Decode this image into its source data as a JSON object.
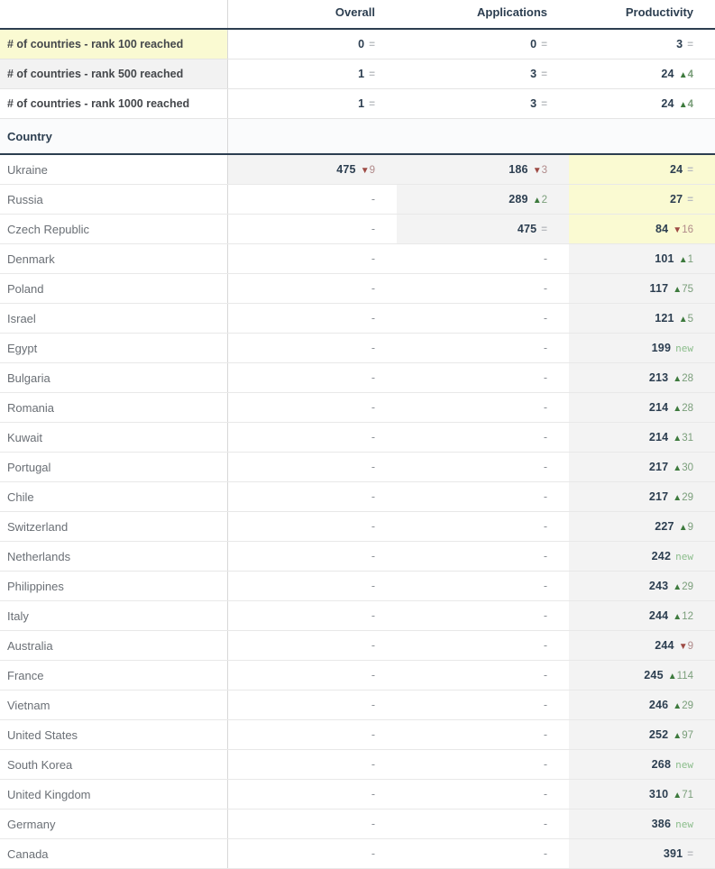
{
  "table": {
    "columns": [
      "",
      "Overall",
      "Applications",
      "Productivity"
    ],
    "summary_rows": [
      {
        "label": "# of countries - rank 100 reached",
        "highlight": "yellow",
        "cells": [
          {
            "value": "0",
            "delta": "=",
            "dir": "same"
          },
          {
            "value": "0",
            "delta": "=",
            "dir": "same"
          },
          {
            "value": "3",
            "delta": "=",
            "dir": "same"
          }
        ]
      },
      {
        "label": "# of countries - rank 500 reached",
        "highlight": "alt",
        "cells": [
          {
            "value": "1",
            "delta": "=",
            "dir": "same"
          },
          {
            "value": "3",
            "delta": "=",
            "dir": "same"
          },
          {
            "value": "24",
            "delta": "4",
            "dir": "up"
          }
        ]
      },
      {
        "label": "# of countries - rank 1000 reached",
        "highlight": "none",
        "cells": [
          {
            "value": "1",
            "delta": "=",
            "dir": "same"
          },
          {
            "value": "3",
            "delta": "=",
            "dir": "same"
          },
          {
            "value": "24",
            "delta": "4",
            "dir": "up"
          }
        ]
      }
    ],
    "section_label": "Country",
    "rows": [
      {
        "country": "Ukraine",
        "cells": [
          {
            "value": "475",
            "delta": "9",
            "dir": "down",
            "bg": "filled"
          },
          {
            "value": "186",
            "delta": "3",
            "dir": "down",
            "bg": "filled"
          },
          {
            "value": "24",
            "delta": "=",
            "dir": "same",
            "bg": "yellow"
          }
        ]
      },
      {
        "country": "Russia",
        "cells": [
          {
            "value": "-",
            "delta": "",
            "dir": "none",
            "bg": "white"
          },
          {
            "value": "289",
            "delta": "2",
            "dir": "up",
            "bg": "filled"
          },
          {
            "value": "27",
            "delta": "=",
            "dir": "same",
            "bg": "yellow"
          }
        ]
      },
      {
        "country": "Czech Republic",
        "cells": [
          {
            "value": "-",
            "delta": "",
            "dir": "none",
            "bg": "white"
          },
          {
            "value": "475",
            "delta": "=",
            "dir": "same",
            "bg": "filled"
          },
          {
            "value": "84",
            "delta": "16",
            "dir": "down",
            "bg": "yellow"
          }
        ]
      },
      {
        "country": "Denmark",
        "cells": [
          {
            "value": "-",
            "delta": "",
            "dir": "none",
            "bg": "white"
          },
          {
            "value": "-",
            "delta": "",
            "dir": "none",
            "bg": "white"
          },
          {
            "value": "101",
            "delta": "1",
            "dir": "up",
            "bg": "filled"
          }
        ]
      },
      {
        "country": "Poland",
        "cells": [
          {
            "value": "-",
            "delta": "",
            "dir": "none",
            "bg": "white"
          },
          {
            "value": "-",
            "delta": "",
            "dir": "none",
            "bg": "white"
          },
          {
            "value": "117",
            "delta": "75",
            "dir": "up",
            "bg": "filled"
          }
        ]
      },
      {
        "country": "Israel",
        "cells": [
          {
            "value": "-",
            "delta": "",
            "dir": "none",
            "bg": "white"
          },
          {
            "value": "-",
            "delta": "",
            "dir": "none",
            "bg": "white"
          },
          {
            "value": "121",
            "delta": "5",
            "dir": "up",
            "bg": "filled"
          }
        ]
      },
      {
        "country": "Egypt",
        "cells": [
          {
            "value": "-",
            "delta": "",
            "dir": "none",
            "bg": "white"
          },
          {
            "value": "-",
            "delta": "",
            "dir": "none",
            "bg": "white"
          },
          {
            "value": "199",
            "delta": "new",
            "dir": "new",
            "bg": "filled"
          }
        ]
      },
      {
        "country": "Bulgaria",
        "cells": [
          {
            "value": "-",
            "delta": "",
            "dir": "none",
            "bg": "white"
          },
          {
            "value": "-",
            "delta": "",
            "dir": "none",
            "bg": "white"
          },
          {
            "value": "213",
            "delta": "28",
            "dir": "up",
            "bg": "filled"
          }
        ]
      },
      {
        "country": "Romania",
        "cells": [
          {
            "value": "-",
            "delta": "",
            "dir": "none",
            "bg": "white"
          },
          {
            "value": "-",
            "delta": "",
            "dir": "none",
            "bg": "white"
          },
          {
            "value": "214",
            "delta": "28",
            "dir": "up",
            "bg": "filled"
          }
        ]
      },
      {
        "country": "Kuwait",
        "cells": [
          {
            "value": "-",
            "delta": "",
            "dir": "none",
            "bg": "white"
          },
          {
            "value": "-",
            "delta": "",
            "dir": "none",
            "bg": "white"
          },
          {
            "value": "214",
            "delta": "31",
            "dir": "up",
            "bg": "filled"
          }
        ]
      },
      {
        "country": "Portugal",
        "cells": [
          {
            "value": "-",
            "delta": "",
            "dir": "none",
            "bg": "white"
          },
          {
            "value": "-",
            "delta": "",
            "dir": "none",
            "bg": "white"
          },
          {
            "value": "217",
            "delta": "30",
            "dir": "up",
            "bg": "filled"
          }
        ]
      },
      {
        "country": "Chile",
        "cells": [
          {
            "value": "-",
            "delta": "",
            "dir": "none",
            "bg": "white"
          },
          {
            "value": "-",
            "delta": "",
            "dir": "none",
            "bg": "white"
          },
          {
            "value": "217",
            "delta": "29",
            "dir": "up",
            "bg": "filled"
          }
        ]
      },
      {
        "country": "Switzerland",
        "cells": [
          {
            "value": "-",
            "delta": "",
            "dir": "none",
            "bg": "white"
          },
          {
            "value": "-",
            "delta": "",
            "dir": "none",
            "bg": "white"
          },
          {
            "value": "227",
            "delta": "9",
            "dir": "up",
            "bg": "filled"
          }
        ]
      },
      {
        "country": "Netherlands",
        "cells": [
          {
            "value": "-",
            "delta": "",
            "dir": "none",
            "bg": "white"
          },
          {
            "value": "-",
            "delta": "",
            "dir": "none",
            "bg": "white"
          },
          {
            "value": "242",
            "delta": "new",
            "dir": "new",
            "bg": "filled"
          }
        ]
      },
      {
        "country": "Philippines",
        "cells": [
          {
            "value": "-",
            "delta": "",
            "dir": "none",
            "bg": "white"
          },
          {
            "value": "-",
            "delta": "",
            "dir": "none",
            "bg": "white"
          },
          {
            "value": "243",
            "delta": "29",
            "dir": "up",
            "bg": "filled"
          }
        ]
      },
      {
        "country": "Italy",
        "cells": [
          {
            "value": "-",
            "delta": "",
            "dir": "none",
            "bg": "white"
          },
          {
            "value": "-",
            "delta": "",
            "dir": "none",
            "bg": "white"
          },
          {
            "value": "244",
            "delta": "12",
            "dir": "up",
            "bg": "filled"
          }
        ]
      },
      {
        "country": "Australia",
        "cells": [
          {
            "value": "-",
            "delta": "",
            "dir": "none",
            "bg": "white"
          },
          {
            "value": "-",
            "delta": "",
            "dir": "none",
            "bg": "white"
          },
          {
            "value": "244",
            "delta": "9",
            "dir": "down",
            "bg": "filled"
          }
        ]
      },
      {
        "country": "France",
        "cells": [
          {
            "value": "-",
            "delta": "",
            "dir": "none",
            "bg": "white"
          },
          {
            "value": "-",
            "delta": "",
            "dir": "none",
            "bg": "white"
          },
          {
            "value": "245",
            "delta": "114",
            "dir": "up",
            "bg": "filled"
          }
        ]
      },
      {
        "country": "Vietnam",
        "cells": [
          {
            "value": "-",
            "delta": "",
            "dir": "none",
            "bg": "white"
          },
          {
            "value": "-",
            "delta": "",
            "dir": "none",
            "bg": "white"
          },
          {
            "value": "246",
            "delta": "29",
            "dir": "up",
            "bg": "filled"
          }
        ]
      },
      {
        "country": "United States",
        "cells": [
          {
            "value": "-",
            "delta": "",
            "dir": "none",
            "bg": "white"
          },
          {
            "value": "-",
            "delta": "",
            "dir": "none",
            "bg": "white"
          },
          {
            "value": "252",
            "delta": "97",
            "dir": "up",
            "bg": "filled"
          }
        ]
      },
      {
        "country": "South Korea",
        "cells": [
          {
            "value": "-",
            "delta": "",
            "dir": "none",
            "bg": "white"
          },
          {
            "value": "-",
            "delta": "",
            "dir": "none",
            "bg": "white"
          },
          {
            "value": "268",
            "delta": "new",
            "dir": "new",
            "bg": "filled"
          }
        ]
      },
      {
        "country": "United Kingdom",
        "cells": [
          {
            "value": "-",
            "delta": "",
            "dir": "none",
            "bg": "white"
          },
          {
            "value": "-",
            "delta": "",
            "dir": "none",
            "bg": "white"
          },
          {
            "value": "310",
            "delta": "71",
            "dir": "up",
            "bg": "filled"
          }
        ]
      },
      {
        "country": "Germany",
        "cells": [
          {
            "value": "-",
            "delta": "",
            "dir": "none",
            "bg": "white"
          },
          {
            "value": "-",
            "delta": "",
            "dir": "none",
            "bg": "white"
          },
          {
            "value": "386",
            "delta": "new",
            "dir": "new",
            "bg": "filled"
          }
        ]
      },
      {
        "country": "Canada",
        "cells": [
          {
            "value": "-",
            "delta": "",
            "dir": "none",
            "bg": "white"
          },
          {
            "value": "-",
            "delta": "",
            "dir": "none",
            "bg": "white"
          },
          {
            "value": "391",
            "delta": "=",
            "dir": "same",
            "bg": "filled"
          }
        ]
      }
    ]
  },
  "colors": {
    "highlight_yellow": "#fafad2",
    "filled_gray": "#f3f3f3",
    "header_navy": "#2c3e50",
    "up_green": "#7a9e7a",
    "down_red": "#b08a8a",
    "new_green": "#8bbd8b"
  }
}
